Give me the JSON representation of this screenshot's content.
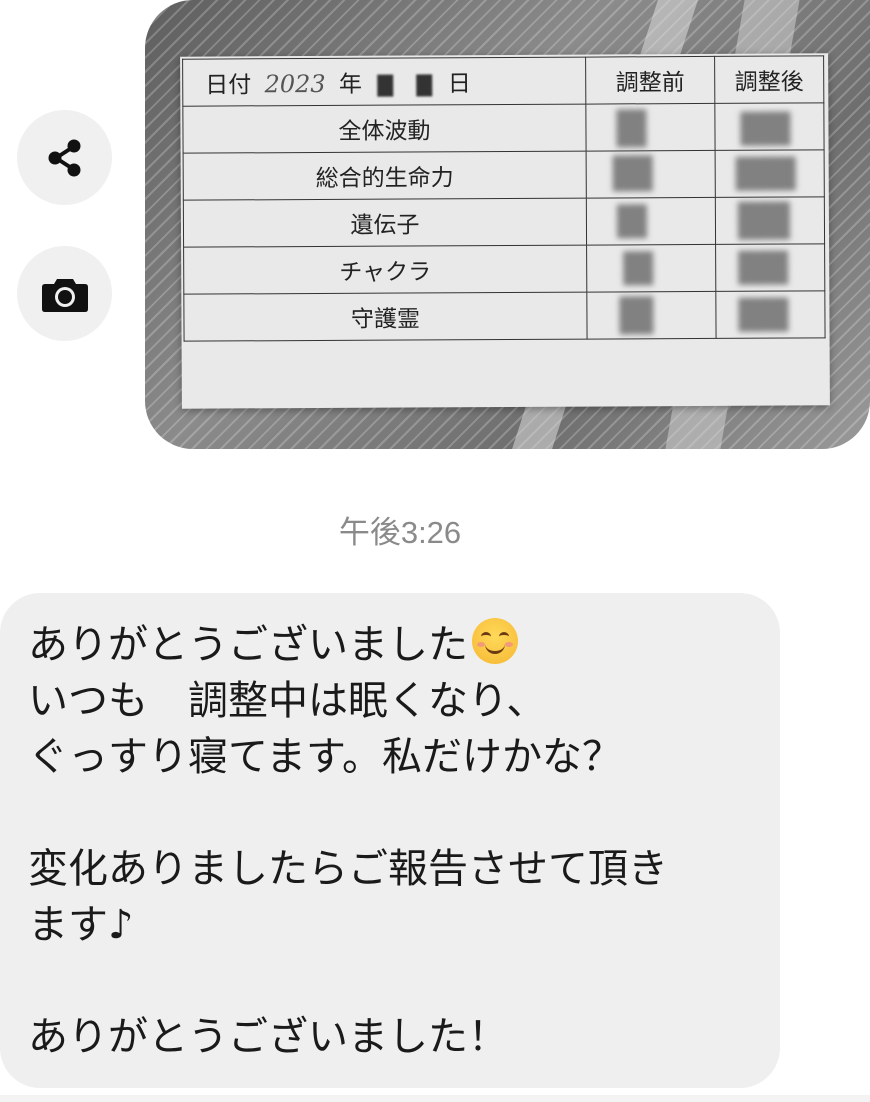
{
  "side_buttons": {
    "share_icon": "share-icon",
    "camera_icon": "camera-icon"
  },
  "photo": {
    "table_header": {
      "date_label": "日付",
      "year_handwritten": "2023",
      "year_label": "年",
      "day_label": "日",
      "col_before": "調整前",
      "col_after": "調整後"
    },
    "rows": [
      "全体波動",
      "総合的生命力",
      "遺伝子",
      "チャクラ",
      "守護霊"
    ]
  },
  "timestamp": "午後3:26",
  "message": {
    "lines": [
      "ありがとうございました",
      "いつも　調整中は眠くなり、",
      "ぐっすり寝てます。私だけかな？",
      "",
      "変化ありましたらご報告させて頂き",
      "ます♪",
      "",
      "ありがとうございました！"
    ],
    "emoji": "smiling-face-emoji"
  },
  "colors": {
    "bubble_bg": "#efefef",
    "timestamp": "#8a8a8a",
    "icon_bg": "#f0f0f0"
  }
}
